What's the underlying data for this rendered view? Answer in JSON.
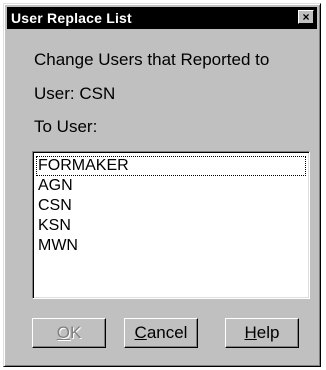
{
  "window": {
    "title": "User Replace List",
    "close_glyph": "×"
  },
  "labels": {
    "heading": "Change Users that Reported to",
    "user": "User:  CSN",
    "to_user": "To User:"
  },
  "list": {
    "items": [
      "FORMAKER",
      "AGN",
      "CSN",
      "KSN",
      "MWN"
    ],
    "focused_index": 0
  },
  "buttons": {
    "ok": {
      "mnemonic": "O",
      "rest": "K",
      "enabled": false
    },
    "cancel": {
      "mnemonic": "C",
      "rest": "ancel",
      "enabled": true
    },
    "help": {
      "mnemonic": "H",
      "rest": "elp",
      "enabled": true
    }
  },
  "icons": {
    "close": "close-icon"
  }
}
